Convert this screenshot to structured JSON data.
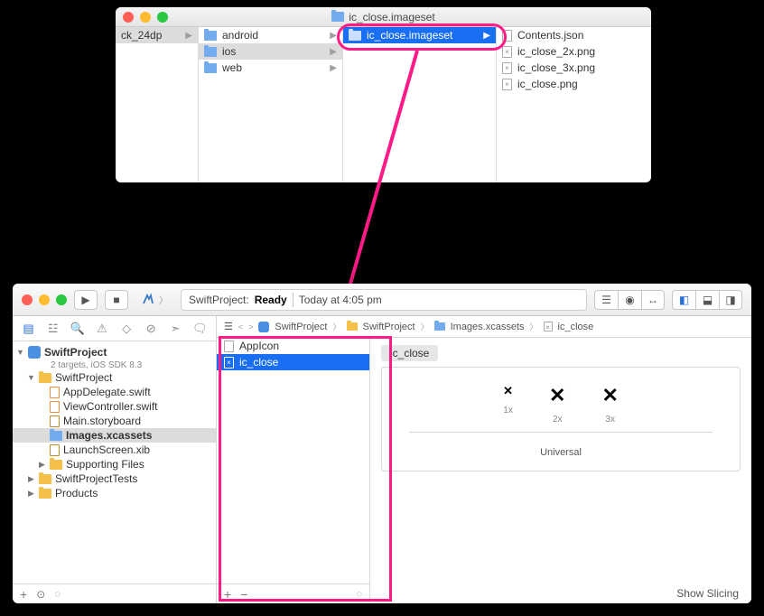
{
  "finder": {
    "title": "ic_close.imageset",
    "col0": [
      {
        "label": "ck_24dp"
      }
    ],
    "col1": [
      {
        "label": "android"
      },
      {
        "label": "ios"
      },
      {
        "label": "web"
      }
    ],
    "col2": [
      {
        "label": "ic_close.imageset"
      }
    ],
    "col3": [
      {
        "label": "Contents.json",
        "icon": "file"
      },
      {
        "label": "ic_close_2x.png",
        "icon": "x"
      },
      {
        "label": "ic_close_3x.png",
        "icon": "x"
      },
      {
        "label": "ic_close.png",
        "icon": "x"
      }
    ]
  },
  "xcode": {
    "status": {
      "project": "SwiftProject:",
      "state": "Ready",
      "sep": "|",
      "time": "Today at 4:05 pm"
    },
    "tree": {
      "root": "SwiftProject",
      "root_sub": "2 targets, iOS SDK 8.3",
      "group": "SwiftProject",
      "files": [
        "AppDelegate.swift",
        "ViewController.swift",
        "Main.storyboard",
        "Images.xcassets",
        "LaunchScreen.xib"
      ],
      "support": "Supporting Files",
      "tests": "SwiftProjectTests",
      "products": "Products"
    },
    "jump": [
      "SwiftProject",
      "SwiftProject",
      "Images.xcassets",
      "ic_close"
    ],
    "assets": {
      "app": "AppIcon",
      "close": "ic_close"
    },
    "canvas": {
      "name": "ic_close",
      "s1": "1x",
      "s2": "2x",
      "s3": "3x",
      "universal": "Universal",
      "slicing": "Show Slicing"
    }
  }
}
